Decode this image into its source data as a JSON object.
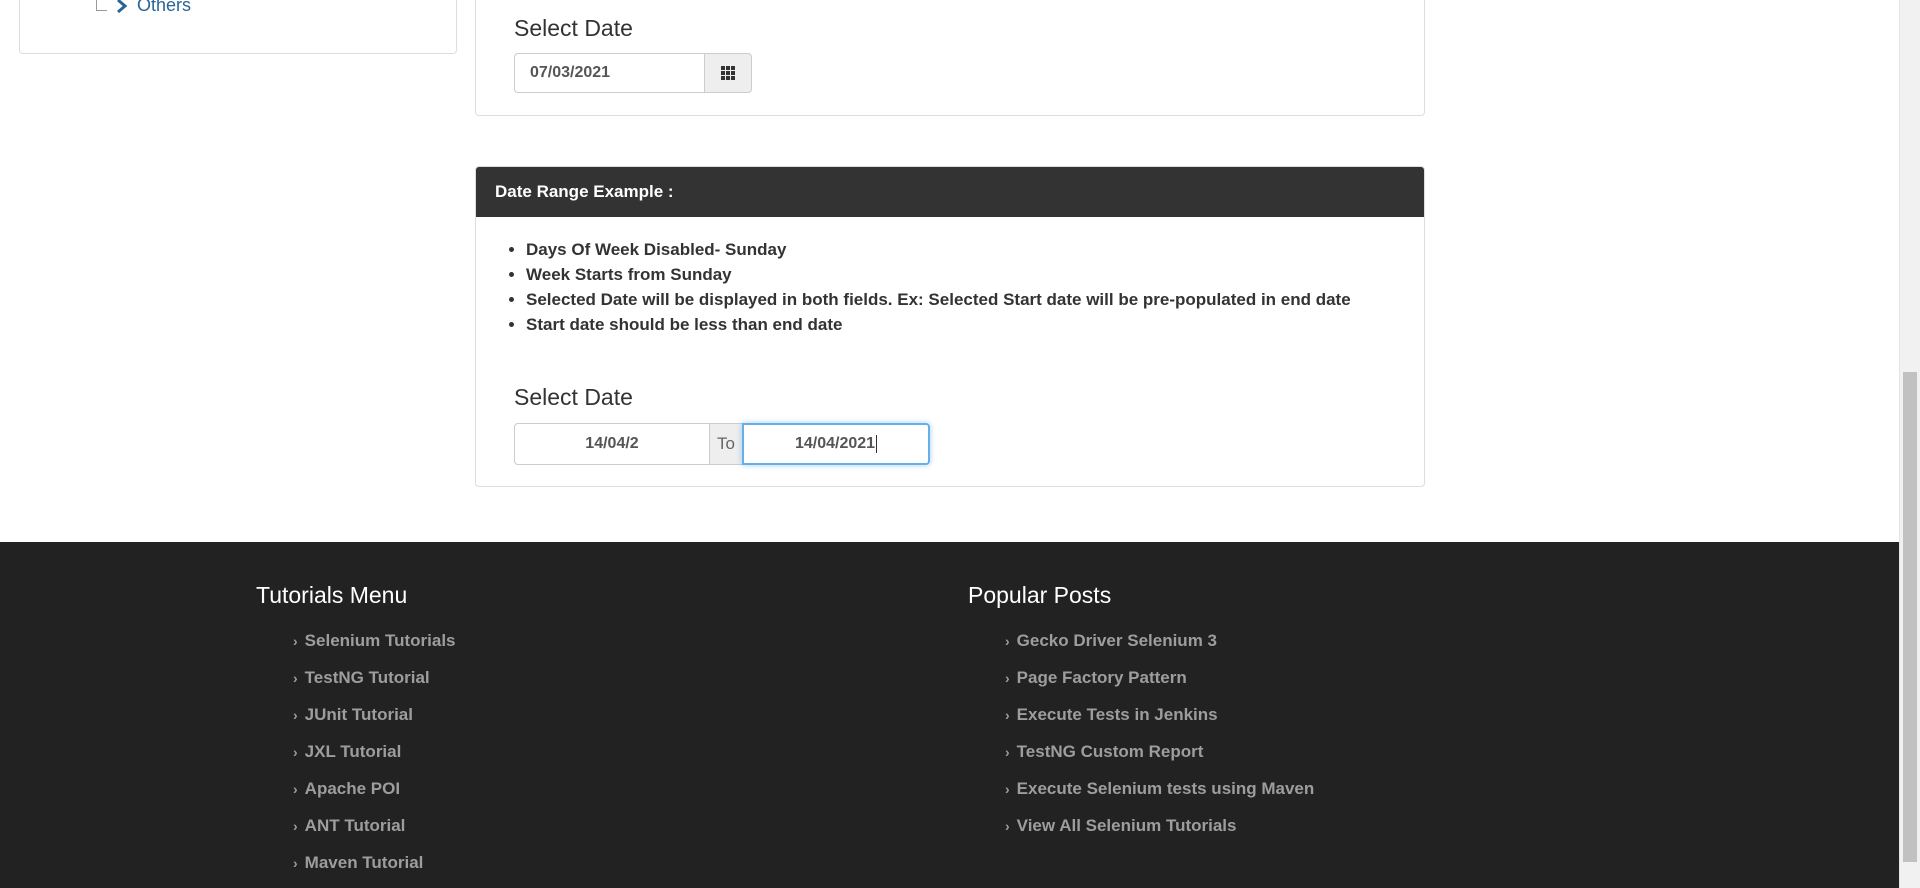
{
  "sidebar": {
    "others_label": "Others"
  },
  "single_date": {
    "label": "Select Date",
    "value": "07/03/2021"
  },
  "date_range": {
    "heading": "Date Range Example :",
    "bullets": [
      "Days Of Week Disabled- Sunday",
      "Week Starts from Sunday",
      "Selected Date will be displayed in both fields. Ex: Selected Start date will be pre-populated in end date",
      "Start date should be less than end date"
    ],
    "label": "Select Date",
    "start_value": "14/04/2",
    "to_label": "To",
    "end_value": "14/04/2021"
  },
  "footer": {
    "tutorials": {
      "title": "Tutorials Menu",
      "items": [
        "Selenium Tutorials",
        "TestNG Tutorial",
        "JUnit Tutorial",
        "JXL Tutorial",
        "Apache POI",
        "ANT Tutorial",
        "Maven Tutorial"
      ]
    },
    "popular": {
      "title": "Popular Posts",
      "items": [
        "Gecko Driver Selenium 3",
        "Page Factory Pattern",
        "Execute Tests in Jenkins",
        "TestNG Custom Report",
        "Execute Selenium tests using Maven",
        "View All Selenium Tutorials"
      ]
    }
  },
  "colors": {
    "heading_bg": "#333333",
    "footer_bg": "#222222",
    "link": "#2a6496",
    "focus": "#66afe9"
  }
}
